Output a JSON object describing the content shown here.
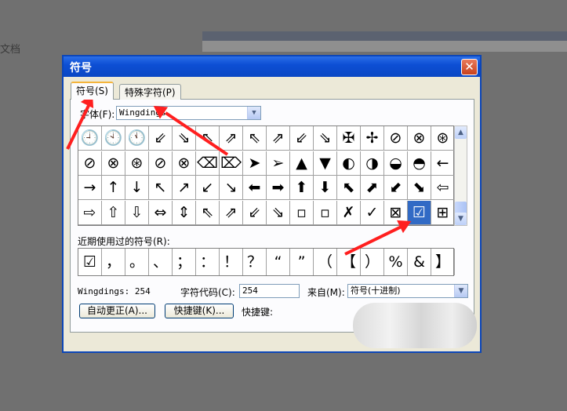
{
  "background": {
    "doc_label": "文档"
  },
  "dialog": {
    "title": "符号",
    "close_symbol": "✕",
    "tabs": [
      {
        "label": "符号(S)"
      },
      {
        "label": "特殊字符(P)"
      }
    ],
    "font_label": "字体(F):",
    "font_value": "Wingdings",
    "grid_rows": [
      [
        "🕘",
        "🕙",
        "🕚",
        "⇙",
        "⇘",
        "⇖",
        "⇗",
        "⇖",
        "⇗",
        "⇙",
        "⇘",
        "✠",
        "✢",
        "⊘",
        "⊗",
        "⊛"
      ],
      [
        "⊘",
        "⊗",
        "⊛",
        "⊘",
        "⊗",
        "⌫",
        "⌦",
        "➤",
        "➢",
        "▲",
        "▼",
        "◐",
        "◑",
        "◒",
        "◓",
        "←"
      ],
      [
        "→",
        "↑",
        "↓",
        "↖",
        "↗",
        "↙",
        "↘",
        "⬅",
        "➡",
        "⬆",
        "⬇",
        "⬉",
        "⬈",
        "⬋",
        "⬊",
        "⇦"
      ],
      [
        "⇨",
        "⇧",
        "⇩",
        "⇔",
        "⇕",
        "⇖",
        "⇗",
        "⇙",
        "⇘",
        "▫",
        "▫",
        "✗",
        "✓",
        "⊠",
        "☑",
        "⊞"
      ]
    ],
    "recent_label": "近期使用过的符号(R):",
    "recent_symbols": [
      "☑",
      "，",
      "。",
      "、",
      "；",
      "：",
      "！",
      "？",
      "“",
      "”",
      "（",
      "【",
      "）",
      "%",
      "&",
      "】"
    ],
    "char_name": "Wingdings: 254",
    "code_label": "字符代码(C):",
    "code_value": "254",
    "from_label": "来自(M):",
    "from_value": "符号(十进制)",
    "autocorrect_btn": "自动更正(A)...",
    "shortcut_btn": "快捷键(K)...",
    "shortcut_label": "快捷键:"
  }
}
